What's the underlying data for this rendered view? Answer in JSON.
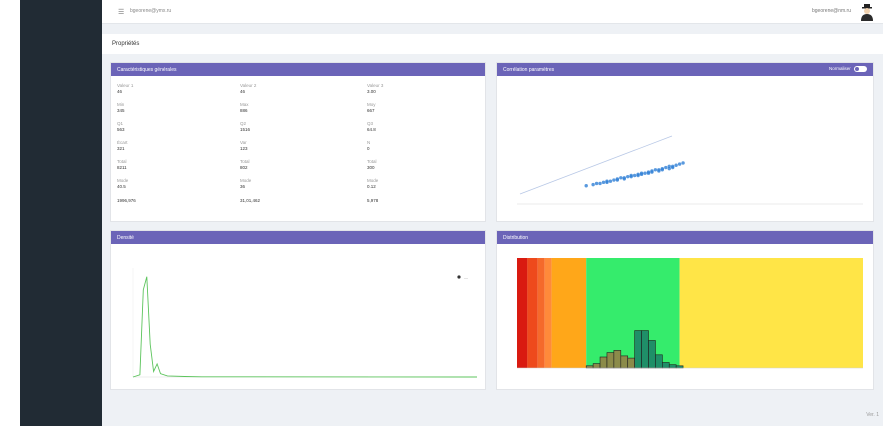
{
  "topbar": {
    "menu_icon": "hamburger-icon",
    "email": "bgeorene@ymx.ru",
    "user_label": "bgeorene@nm.ru",
    "avatar_icon": "user-avatar-icon"
  },
  "page": {
    "title": "Propriétés"
  },
  "panels": {
    "stats": {
      "title": "Caractéristiques générales"
    },
    "scatter": {
      "title": "Corrélation paramètres",
      "toggle_label": "Normaliser"
    },
    "density": {
      "title": "Densité",
      "legend_label": "—"
    },
    "histogram": {
      "title": "Distribution"
    }
  },
  "stats": [
    [
      {
        "label": "Valeur 1",
        "value": "46"
      },
      {
        "label": "Valeur 2",
        "value": "46"
      },
      {
        "label": "Valeur 3",
        "value": "3.00"
      }
    ],
    [
      {
        "label": "Min",
        "value": "345"
      },
      {
        "label": "Max",
        "value": "886"
      },
      {
        "label": "Moy",
        "value": "667"
      }
    ],
    [
      {
        "label": "Q1",
        "value": "563"
      },
      {
        "label": "Q2",
        "value": "1516"
      },
      {
        "label": "Q3",
        "value": "64.8"
      }
    ],
    [
      {
        "label": "Écart",
        "value": "321"
      },
      {
        "label": "Var",
        "value": "123"
      },
      {
        "label": "N",
        "value": "0"
      }
    ],
    [
      {
        "label": "Total",
        "value": "8211"
      },
      {
        "label": "Total",
        "value": "802"
      },
      {
        "label": "Total",
        "value": "300"
      }
    ],
    [
      {
        "label": "Mode",
        "value": "40.5"
      },
      {
        "label": "Mode",
        "value": "36"
      },
      {
        "label": "Mode",
        "value": "0.12"
      }
    ],
    [
      {
        "label": "",
        "value": "1996,976"
      },
      {
        "label": "",
        "value": "31,01,462"
      },
      {
        "label": "",
        "value": "5,978"
      }
    ]
  ],
  "footer": {
    "text": "Ver. 1"
  },
  "chart_data": [
    {
      "type": "scatter",
      "title": "",
      "xlabel": "",
      "ylabel": "",
      "xlim": [
        0,
        100
      ],
      "ylim": [
        0,
        100
      ],
      "points": [
        [
          20,
          16
        ],
        [
          22,
          17
        ],
        [
          23,
          18
        ],
        [
          24,
          18
        ],
        [
          25,
          19
        ],
        [
          26,
          20
        ],
        [
          27,
          20
        ],
        [
          28,
          21
        ],
        [
          29,
          22
        ],
        [
          30,
          23
        ],
        [
          31,
          23
        ],
        [
          32,
          24
        ],
        [
          33,
          25
        ],
        [
          34,
          25
        ],
        [
          35,
          26
        ],
        [
          36,
          27
        ],
        [
          37,
          27
        ],
        [
          38,
          28
        ],
        [
          39,
          29
        ],
        [
          40,
          30
        ],
        [
          41,
          30
        ],
        [
          42,
          31
        ],
        [
          43,
          32
        ],
        [
          44,
          33
        ],
        [
          45,
          33
        ],
        [
          46,
          34
        ],
        [
          47,
          35
        ],
        [
          48,
          36
        ],
        [
          26,
          19
        ],
        [
          29,
          21
        ],
        [
          33,
          24
        ],
        [
          36,
          26
        ],
        [
          39,
          28
        ],
        [
          42,
          30
        ],
        [
          45,
          32
        ],
        [
          31,
          22
        ],
        [
          35,
          25
        ],
        [
          38,
          27
        ],
        [
          41,
          29
        ],
        [
          44,
          31
        ]
      ],
      "colors": {
        "points": "#2f7fd6"
      }
    },
    {
      "type": "line",
      "title": "",
      "xlabel": "",
      "ylabel": "",
      "xlim": [
        0,
        100
      ],
      "ylim": [
        0,
        100
      ],
      "x": [
        0,
        2,
        3,
        4,
        5,
        6,
        7,
        8,
        10,
        15,
        20,
        100
      ],
      "series": [
        {
          "values": [
            0,
            2,
            80,
            92,
            30,
            5,
            12,
            3,
            1,
            0.5,
            0.2,
            0
          ]
        }
      ],
      "colors": {
        "line": "#5cc45c"
      }
    },
    {
      "type": "bar",
      "title": "",
      "xlabel": "",
      "ylabel": "",
      "xlim": [
        0,
        100
      ],
      "ylim": [
        0,
        100
      ],
      "bins": [
        {
          "x0": 20,
          "x1": 22,
          "value": 2
        },
        {
          "x0": 22,
          "x1": 24,
          "value": 4
        },
        {
          "x0": 24,
          "x1": 26,
          "value": 10
        },
        {
          "x0": 26,
          "x1": 28,
          "value": 14
        },
        {
          "x0": 28,
          "x1": 30,
          "value": 16
        },
        {
          "x0": 30,
          "x1": 32,
          "value": 11
        },
        {
          "x0": 32,
          "x1": 34,
          "value": 9
        },
        {
          "x0": 34,
          "x1": 36,
          "value": 34
        },
        {
          "x0": 36,
          "x1": 38,
          "value": 34
        },
        {
          "x0": 38,
          "x1": 40,
          "value": 25
        },
        {
          "x0": 40,
          "x1": 42,
          "value": 12
        },
        {
          "x0": 42,
          "x1": 44,
          "value": 5
        },
        {
          "x0": 44,
          "x1": 46,
          "value": 3
        },
        {
          "x0": 46,
          "x1": 48,
          "value": 2
        }
      ],
      "bands": [
        {
          "from": 0,
          "to": 3,
          "color": "#d91a10"
        },
        {
          "from": 3,
          "to": 6,
          "color": "#ee4a1c"
        },
        {
          "from": 6,
          "to": 8,
          "color": "#f56a2b"
        },
        {
          "from": 8,
          "to": 10,
          "color": "#ff8a3a"
        },
        {
          "from": 10,
          "to": 20,
          "color": "#ffa719"
        },
        {
          "from": 20,
          "to": 47,
          "color": "#35ec6c"
        },
        {
          "from": 47,
          "to": 100,
          "color": "#ffe547"
        }
      ],
      "colors": {
        "bar": "#1f8f68",
        "bar_low": "#8b8b4a",
        "outline": "#1f1f1f"
      }
    }
  ]
}
